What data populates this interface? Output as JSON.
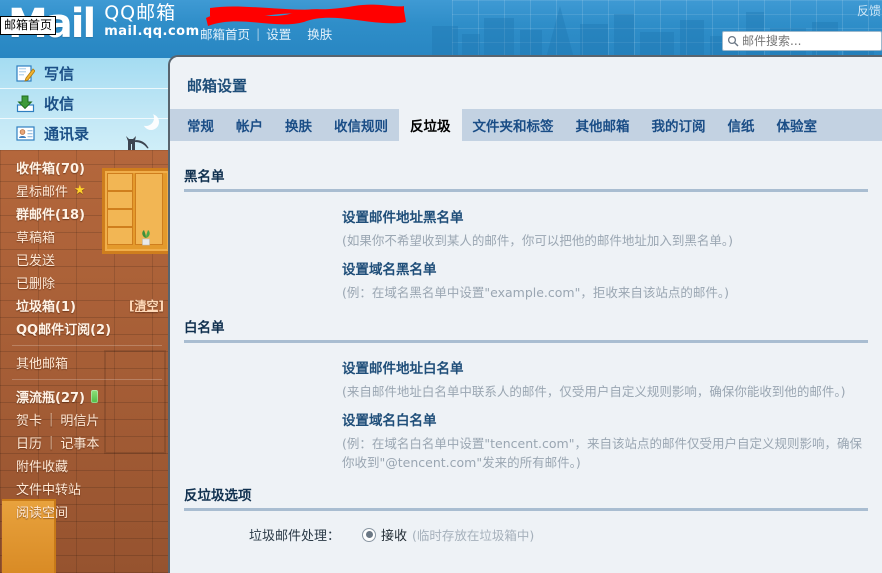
{
  "banner": {
    "logo_mail": "Mail",
    "logo_cn": "QQ邮箱",
    "logo_url": "mail.qq.com",
    "nav": [
      {
        "label": "邮箱首页",
        "icon": "home-icon"
      },
      {
        "label": "设置",
        "icon": "gear-icon"
      },
      {
        "label": "换肤",
        "icon": "skin-icon"
      }
    ],
    "nav_separator": "|",
    "feedback_label": "反馈",
    "home_tooltip": "邮箱首页"
  },
  "search": {
    "placeholder": "邮件搜索...",
    "value": "",
    "icon": "search-icon"
  },
  "sidebar": {
    "top_actions": [
      {
        "label": "写信",
        "icon": "compose-icon"
      },
      {
        "label": "收信",
        "icon": "receive-icon"
      },
      {
        "label": "通讯录",
        "icon": "contacts-icon"
      }
    ],
    "folders": [
      {
        "label": "收件箱(70)",
        "bold": true
      },
      {
        "label": "星标邮件",
        "bold": false,
        "star": "★"
      },
      {
        "label": "群邮件(18)",
        "bold": true
      },
      {
        "label": "草稿箱",
        "bold": false
      },
      {
        "label": "已发送",
        "bold": false
      },
      {
        "label": "已删除",
        "bold": false
      },
      {
        "label": "垃圾箱(1)",
        "bold": true,
        "action": "[清空]"
      },
      {
        "label": "QQ邮件订阅(2)",
        "bold": true
      }
    ],
    "other_mailbox": "其他邮箱",
    "drift": {
      "label": "漂流瓶(27)",
      "icon": "bottle-icon"
    },
    "extras_pairs": [
      {
        "left": "贺卡",
        "right": "明信片"
      },
      {
        "left": "日历",
        "right": "记事本"
      }
    ],
    "extras": [
      {
        "label": "附件收藏"
      },
      {
        "label": "文件中转站"
      },
      {
        "label": "阅读空间"
      }
    ]
  },
  "panel": {
    "title": "邮箱设置",
    "tabs": [
      {
        "label": "常规",
        "active": false
      },
      {
        "label": "帐户",
        "active": false
      },
      {
        "label": "换肤",
        "active": false
      },
      {
        "label": "收信规则",
        "active": false
      },
      {
        "label": "反垃圾",
        "active": true
      },
      {
        "label": "文件夹和标签",
        "active": false
      },
      {
        "label": "其他邮箱",
        "active": false
      },
      {
        "label": "我的订阅",
        "active": false
      },
      {
        "label": "信纸",
        "active": false
      },
      {
        "label": "体验室",
        "active": false
      }
    ]
  },
  "blacklist": {
    "title": "黑名单",
    "address_link": "设置邮件地址黑名单",
    "address_hint": "(如果你不希望收到某人的邮件，你可以把他的邮件地址加入到黑名单。)",
    "domain_link": "设置域名黑名单",
    "domain_hint": "(例：在域名黑名单中设置\"example.com\"，拒收来自该站点的邮件。)"
  },
  "whitelist": {
    "title": "白名单",
    "address_link": "设置邮件地址白名单",
    "address_hint": "(来自邮件地址白名单中联系人的邮件，仅受用户自定义规则影响，确保你能收到他的邮件。)",
    "domain_link": "设置域名白名单",
    "domain_hint": "(例：在域名白名单中设置\"tencent.com\"，来自该站点的邮件仅受用户自定义规则影响，确保你收到\"@tencent.com\"发来的所有邮件。)"
  },
  "antispam": {
    "title": "反垃圾选项",
    "option_label": "垃圾邮件处理：",
    "radio_label": "接收",
    "radio_hint": "(临时存放在垃圾箱中)",
    "radio_checked": true
  },
  "colors": {
    "banner_blue": "#2f8ec9",
    "panel_bg": "#eef2f6",
    "tabbar_bg": "#c3d2e2",
    "link_blue": "#1f4e79",
    "hint_gray": "#9aa6b2",
    "brick": "#a8613a",
    "redaction_red": "#ff0000"
  }
}
